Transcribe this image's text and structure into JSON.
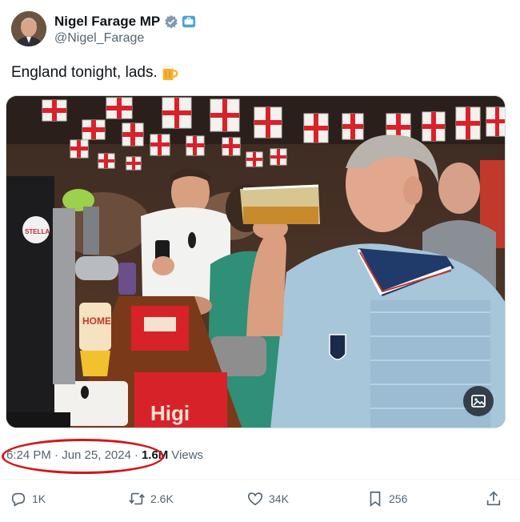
{
  "author": {
    "display_name": "Nigel Farage MP",
    "handle": "@Nigel_Farage",
    "avatar_icon": "avatar-photo",
    "verified_icon": "verified-badge-icon",
    "affiliate_icon": "affiliate-badge-icon"
  },
  "tweet": {
    "text": "England tonight, lads.",
    "emoji_icon": "beer-mug-icon"
  },
  "media": {
    "image_icon": "photo",
    "alt_icon": "media-options-icon"
  },
  "meta": {
    "timestamp": "6:24 PM · Jun 25, 2024",
    "separator": "·",
    "views_count": "1.6M",
    "views_label": "Views"
  },
  "actions": {
    "reply": "1K",
    "repost": "2.6K",
    "like": "34K",
    "bookmark": "256"
  },
  "colors": {
    "text": "#0f1419",
    "secondary": "#536471",
    "verified": "#829aab",
    "annotation": "#d0161e"
  }
}
